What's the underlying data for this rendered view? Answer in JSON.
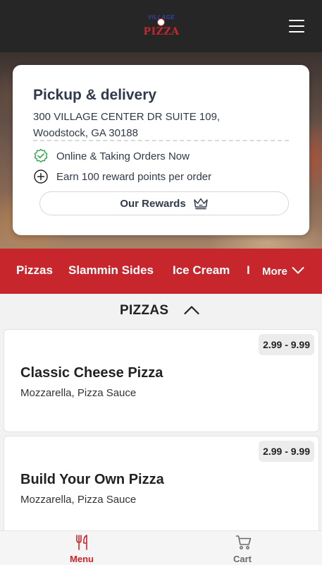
{
  "header": {
    "logo_top_text": "VILLAGE",
    "logo_text": "PIZZA",
    "menu_icon": "hamburger-menu-icon"
  },
  "location": {
    "title": "Pickup & delivery",
    "address_line1": "300 VILLAGE CENTER DR SUITE 109,",
    "address_line2": "Woodstock, GA 30188",
    "status": "Online & Taking Orders Now",
    "rewards_text": "Earn 100 reward points per order",
    "rewards_button": "Our Rewards"
  },
  "categories": {
    "items": [
      "Pizzas",
      "Slammin Sides",
      "Ice Cream",
      "I"
    ],
    "more_label": "More"
  },
  "section": {
    "title": "PIZZAS"
  },
  "menu_items": [
    {
      "name": "Classic Cheese Pizza",
      "description": "Mozzarella, Pizza Sauce",
      "price": "2.99 - 9.99"
    },
    {
      "name": "Build Your Own Pizza",
      "description": "Mozzarella, Pizza Sauce",
      "price": "2.99 - 9.99"
    }
  ],
  "bottom_nav": {
    "menu_label": "Menu",
    "cart_label": "Cart"
  },
  "colors": {
    "brand_red": "#c8262d",
    "header_dark": "#262626",
    "check_green": "#3aa655",
    "text_dark": "#2f3a4a"
  }
}
